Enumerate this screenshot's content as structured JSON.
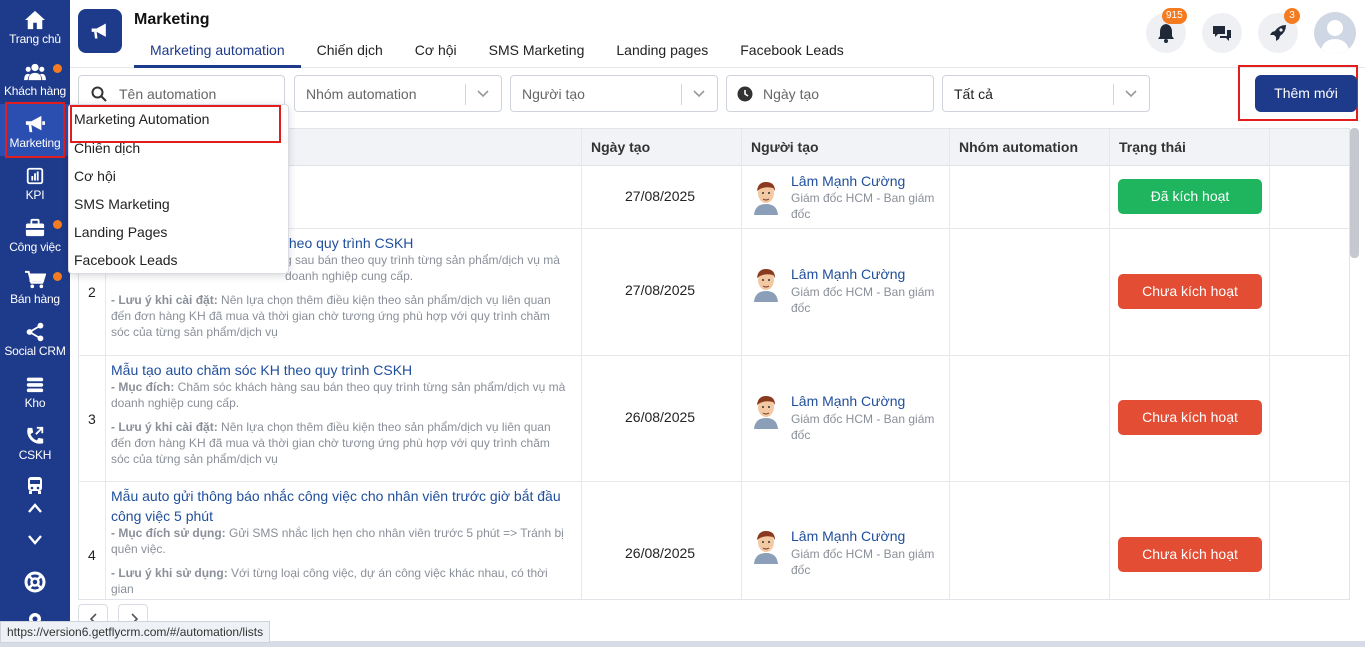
{
  "sidebar": {
    "items": [
      {
        "label": "Trang chủ",
        "icon": "home-icon"
      },
      {
        "label": "Khách hàng",
        "icon": "users-icon",
        "dot": true
      },
      {
        "label": "Marketing",
        "icon": "megaphone-icon",
        "active": true
      },
      {
        "label": "KPI",
        "icon": "bar-chart-icon"
      },
      {
        "label": "Công việc",
        "icon": "briefcase-icon",
        "dot": true
      },
      {
        "label": "Bán hàng",
        "icon": "cart-icon",
        "dot": true
      },
      {
        "label": "Social CRM",
        "icon": "share-icon"
      },
      {
        "label": "Kho",
        "icon": "warehouse-icon"
      },
      {
        "label": "CSKH",
        "icon": "phone-icon"
      }
    ]
  },
  "header": {
    "title": "Marketing",
    "tabs": [
      "Marketing automation",
      "Chiến dịch",
      "Cơ hội",
      "SMS Marketing",
      "Landing pages",
      "Facebook Leads"
    ],
    "active_tab": 0,
    "notification_count": "915",
    "rocket_count": "3"
  },
  "filters": {
    "search_placeholder": "Tên automation",
    "group_placeholder": "Nhóm automation",
    "creator_placeholder": "Người tạo",
    "date_placeholder": "Ngày tạo",
    "status_value": "Tất cả",
    "add_button": "Thêm mới"
  },
  "dropdown": {
    "items": [
      "Marketing Automation",
      "Chiến dịch",
      "Cơ hội",
      "SMS Marketing",
      "Landing Pages",
      "Facebook Leads"
    ]
  },
  "table": {
    "headers": {
      "date": "Ngày tạo",
      "creator": "Người tạo",
      "group": "Nhóm automation",
      "status": "Trạng thái"
    },
    "rows": [
      {
        "num": "",
        "title": "",
        "desc_purpose_label": "",
        "desc_purpose": "",
        "desc_note_label": "",
        "desc_note": "",
        "date": "27/08/2025",
        "creator_name": "Lâm Mạnh Cường",
        "creator_role": "Giám đốc HCM - Ban giám đốc",
        "status": "Đã kích hoạt"
      },
      {
        "num": "2",
        "title": "theo quy trình CSKH",
        "desc_purpose_label": "",
        "desc_purpose": "g sau bán theo quy trình từng sản phẩm/dịch vụ mà doanh nghiệp cung cấp.",
        "desc_note_label": "- Lưu ý khi cài đặt:",
        "desc_note": " Nên lựa chọn thêm điều kiện theo sản phẩm/dịch vụ liên quan đến đơn hàng KH đã mua và thời gian chờ tương ứng phù hợp với quy trình chăm sóc của từng sản phẩm/dịch vụ",
        "date": "27/08/2025",
        "creator_name": "Lâm Mạnh Cường",
        "creator_role": "Giám đốc HCM - Ban giám đốc",
        "status": "Chưa kích hoạt"
      },
      {
        "num": "3",
        "title": "Mẫu tạo auto chăm sóc KH theo quy trình CSKH",
        "desc_purpose_label": "- Mục đích:",
        "desc_purpose": " Chăm sóc khách hàng sau bán theo quy trình từng sản phẩm/dịch vụ mà doanh nghiệp cung cấp.",
        "desc_note_label": "- Lưu ý khi cài đặt:",
        "desc_note": " Nên lựa chọn thêm điều kiện theo sản phẩm/dịch vụ liên quan đến đơn hàng KH đã mua và thời gian chờ tương ứng phù hợp với quy trình chăm sóc của từng sản phẩm/dịch vụ",
        "date": "26/08/2025",
        "creator_name": "Lâm Mạnh Cường",
        "creator_role": "Giám đốc HCM - Ban giám đốc",
        "status": "Chưa kích hoạt"
      },
      {
        "num": "4",
        "title": "Mẫu auto gửi thông báo nhắc công việc cho nhân viên trước giờ bắt đầu công việc 5 phút",
        "desc_purpose_label": "- Mục đích sử dụng:",
        "desc_purpose": " Gửi SMS nhắc lịch hẹn cho nhân viên trước 5 phút => Tránh bị quên việc.",
        "desc_note_label": "- Lưu ý khi sử dụng:",
        "desc_note": " Với từng loại công việc, dự án công việc khác nhau, có thời gian",
        "date": "26/08/2025",
        "creator_name": "Lâm Mạnh Cường",
        "creator_role": "Giám đốc HCM - Ban giám đốc",
        "status": "Chưa kích hoạt"
      }
    ]
  },
  "statusbar_url": "https://version6.getflycrm.com/#/automation/lists",
  "colors": {
    "brand": "#1e3a8a",
    "active_status": "#1fb45e",
    "inactive_status": "#e24d34",
    "badge": "#f47b20",
    "highlight": "#e11d1d"
  }
}
